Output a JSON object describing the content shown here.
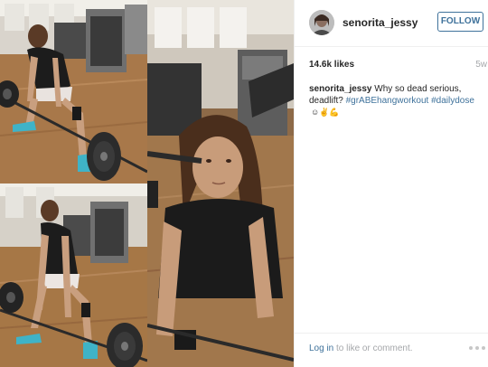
{
  "profile": {
    "username": "senorita_jessy",
    "follow_label": "FOLLOW"
  },
  "stats": {
    "likes": "14.6k likes",
    "time_ago": "5w"
  },
  "caption": {
    "username": "senorita_jessy",
    "text": "Why so dead serious, deadlift?",
    "hashtag_1": "#grABEhangworkout",
    "hashtag_2": "#dailydose",
    "emojis": "☺✌💪"
  },
  "footer": {
    "login_link": "Log in",
    "login_suffix": "to like or comment."
  },
  "colors": {
    "link_blue": "#3f729b",
    "muted_gray": "#a5a7aa",
    "divider": "#efefef"
  },
  "media_icons": [
    "gym-photo-deadlift-start",
    "gym-photo-deadlift-bottom",
    "gym-photo-closeup"
  ]
}
